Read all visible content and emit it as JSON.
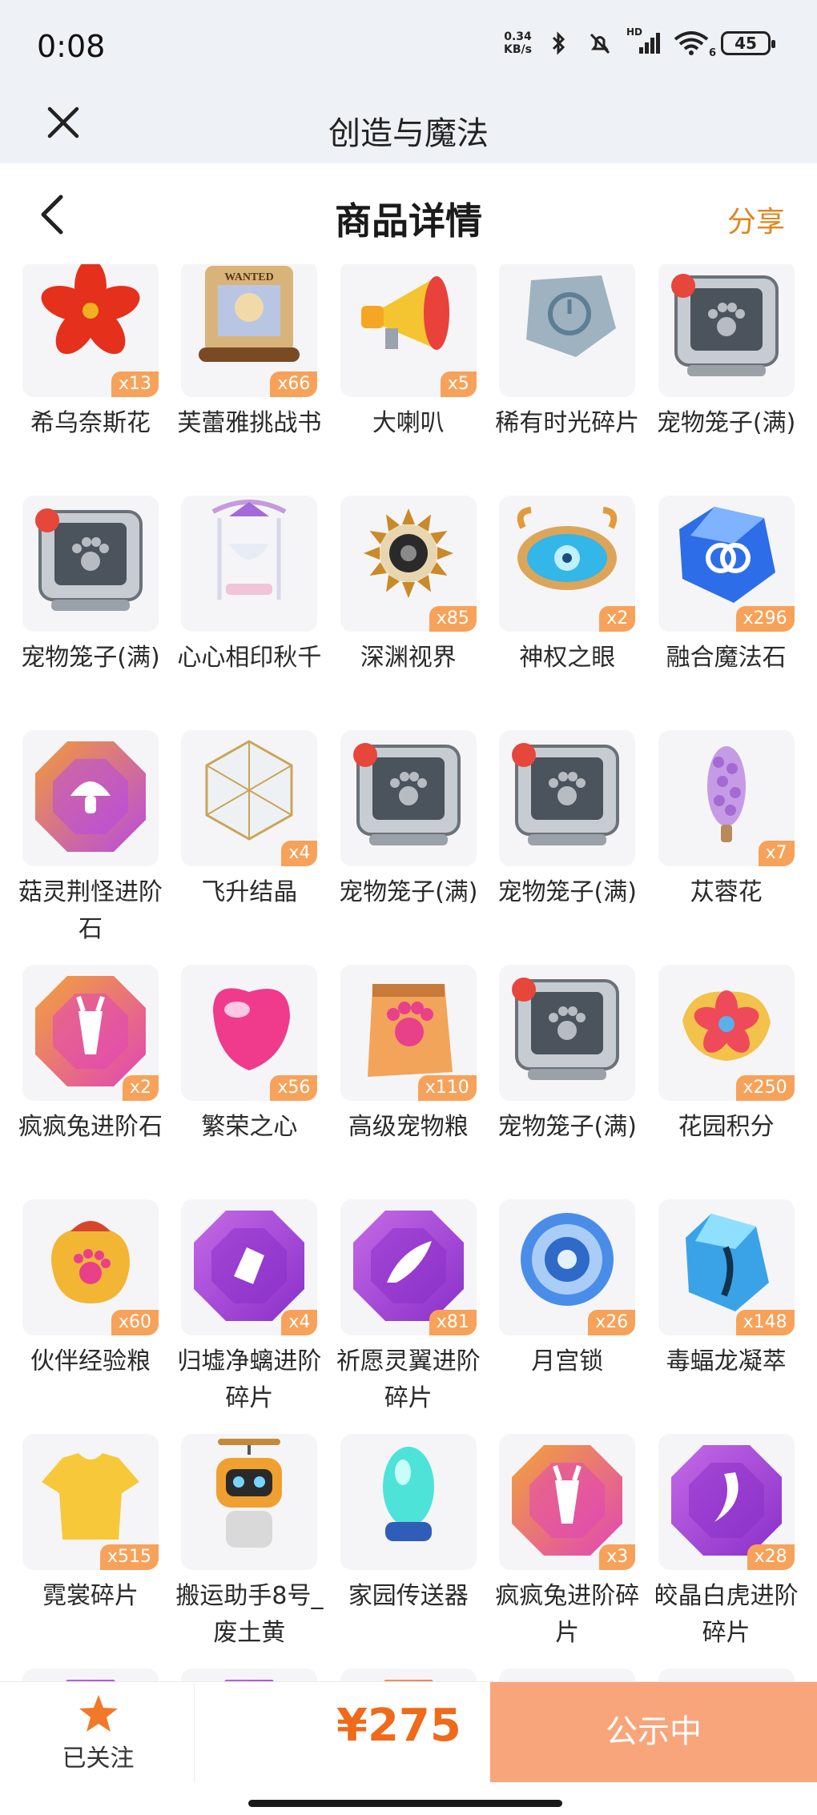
{
  "status_bar": {
    "time": "0:08",
    "net_speed_value": "0.34",
    "net_speed_unit": "KB/s",
    "network_label": "HD",
    "wifi_label": "6",
    "battery": "45"
  },
  "app_bar": {
    "title": "创造与魔法"
  },
  "page_header": {
    "title": "商品详情",
    "share": "分享"
  },
  "items": [
    [
      {
        "name": "希乌奈斯花",
        "qty": "x13",
        "icon": "red-flower-icon"
      },
      {
        "name": "芙蕾雅挑战书",
        "qty": "x66",
        "icon": "wanted-scroll-icon",
        "tag": "WANTED"
      },
      {
        "name": "大喇叭",
        "qty": "x5",
        "icon": "megaphone-icon"
      },
      {
        "name": "稀有时光碎片",
        "qty": "",
        "icon": "time-fragment-icon"
      },
      {
        "name": "宠物笼子(满)",
        "qty": "",
        "icon": "pet-cage-icon"
      }
    ],
    [
      {
        "name": "宠物笼子(满)",
        "qty": "",
        "icon": "pet-cage-icon"
      },
      {
        "name": "心心相印秋千",
        "qty": "",
        "icon": "swing-icon"
      },
      {
        "name": "深渊视界",
        "qty": "x85",
        "icon": "abyss-sun-icon"
      },
      {
        "name": "神权之眼",
        "qty": "x2",
        "icon": "divine-eye-icon"
      },
      {
        "name": "融合魔法石",
        "qty": "x296",
        "icon": "fusion-stone-icon"
      }
    ],
    [
      {
        "name": "菇灵荆怪进阶石",
        "qty": "",
        "icon": "mushroom-gem-icon"
      },
      {
        "name": "飞升结晶",
        "qty": "x4",
        "icon": "crystal-icon"
      },
      {
        "name": "宠物笼子(满)",
        "qty": "",
        "icon": "pet-cage-icon"
      },
      {
        "name": "宠物笼子(满)",
        "qty": "",
        "icon": "pet-cage-icon"
      },
      {
        "name": "苁蓉花",
        "qty": "x7",
        "icon": "purple-flower-icon"
      }
    ],
    [
      {
        "name": "疯疯兔进阶石",
        "qty": "x2",
        "icon": "rabbit-gem-icon"
      },
      {
        "name": "繁荣之心",
        "qty": "x56",
        "icon": "pink-heart-gem-icon"
      },
      {
        "name": "高级宠物粮",
        "qty": "x110",
        "icon": "pet-food-bag-icon"
      },
      {
        "name": "宠物笼子(满)",
        "qty": "",
        "icon": "pet-cage-icon"
      },
      {
        "name": "花园积分",
        "qty": "x250",
        "icon": "garden-points-icon"
      }
    ],
    [
      {
        "name": "伙伴经验粮",
        "qty": "x60",
        "icon": "exp-food-bag-icon"
      },
      {
        "name": "归墟净螭进阶碎片",
        "qty": "x4",
        "icon": "purple-gem-icon"
      },
      {
        "name": "祈愿灵翼进阶碎片",
        "qty": "x81",
        "icon": "wing-gem-icon"
      },
      {
        "name": "月宫锁",
        "qty": "x26",
        "icon": "moon-lock-icon"
      },
      {
        "name": "毒蝠龙凝萃",
        "qty": "x148",
        "icon": "blue-crystal-icon"
      }
    ],
    [
      {
        "name": "霓裳碎片",
        "qty": "x515",
        "icon": "shirt-icon"
      },
      {
        "name": "搬运助手8号_废土黄",
        "qty": "",
        "icon": "robot-icon"
      },
      {
        "name": "家园传送器",
        "qty": "",
        "icon": "teleporter-icon"
      },
      {
        "name": "疯疯兔进阶碎片",
        "qty": "x3",
        "icon": "rabbit-gem-icon"
      },
      {
        "name": "皎晶白虎进阶碎片",
        "qty": "x28",
        "icon": "tiger-gem-icon"
      }
    ],
    [
      {
        "name": "",
        "qty": "",
        "icon": "purple-gem-icon"
      },
      {
        "name": "",
        "qty": "",
        "icon": "purple-gem-icon"
      },
      {
        "name": "",
        "qty": "",
        "icon": "pink-gem-icon"
      },
      {
        "name": "",
        "qty": "",
        "icon": "creature-icon"
      },
      {
        "name": "",
        "qty": "",
        "icon": "blue-creature-icon"
      }
    ]
  ],
  "bottom_bar": {
    "follow_label": "已关注",
    "price": "¥275",
    "status_button": "公示中"
  },
  "colors": {
    "accent": "#e0851f",
    "price": "#ef6a1a",
    "qty_badge": "#f7a25a",
    "status_button": "#f9a57b",
    "star": "#f07a2a",
    "pet_badge": "#e7463a"
  }
}
